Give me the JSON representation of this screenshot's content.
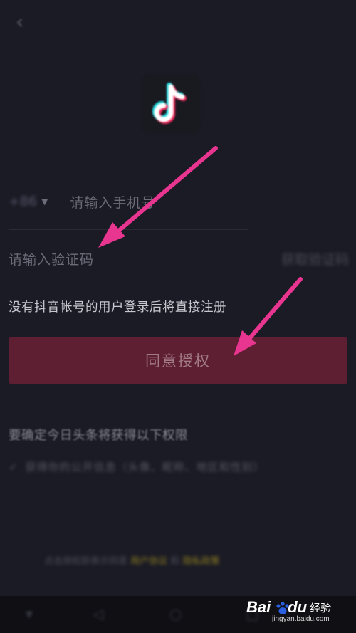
{
  "header": {
    "back_icon": "chevron-left-icon"
  },
  "logo": {
    "icon": "tiktok-note-icon"
  },
  "login": {
    "country_code": "+86",
    "country_caret_icon": "caret-down-icon",
    "phone_placeholder": "请输入手机号",
    "code_placeholder": "请输入验证码",
    "get_code_label": "获取验证码",
    "notice": "没有抖音帐号的用户登录后将直接注册",
    "agree_button": "同意授权"
  },
  "permissions": {
    "title": "要确定今日头条将获得以下权限",
    "item": "获得你的公开信息（头像、昵称、地区和性别）"
  },
  "terms": {
    "prefix": "点击授权即表示同意",
    "link1": "用户协议",
    "middle": "和",
    "link2": "隐私政策"
  },
  "watermark": {
    "brand_left": "Bai",
    "brand_right": "du",
    "brand_cn": "经验",
    "url": "jingyan.baidu.com"
  },
  "colors": {
    "background": "#1b1b25",
    "agree_button": "#5e1f33",
    "arrow": "#e8358f",
    "link": "#8c7c20"
  }
}
